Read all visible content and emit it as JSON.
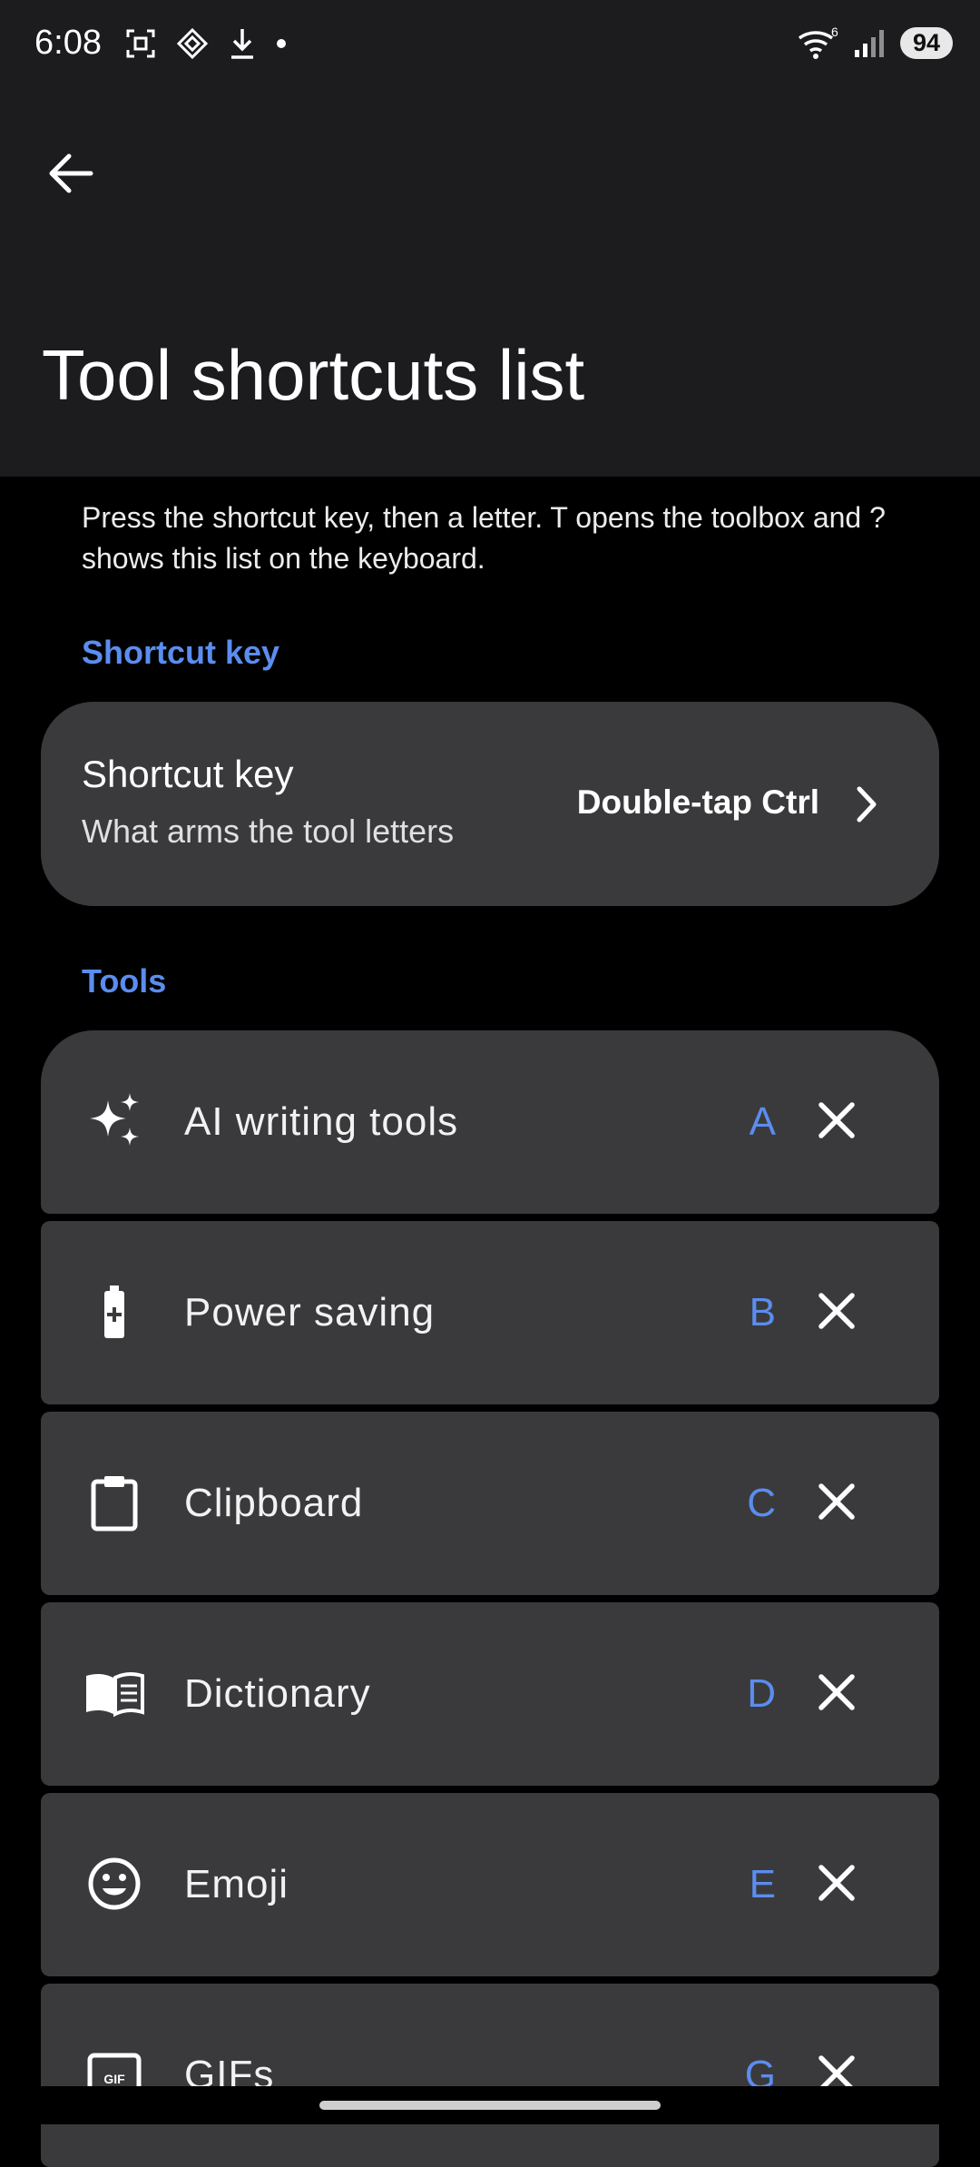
{
  "status": {
    "time": "6:08",
    "battery": "94",
    "icons_left": [
      "screenshot-icon",
      "app-icon",
      "download-icon",
      "dot-icon"
    ],
    "icons_right": [
      "wifi-icon",
      "signal-icon"
    ]
  },
  "header": {
    "title": "Tool shortcuts list",
    "back_icon": "arrow-left-icon"
  },
  "description": "Press the shortcut key, then a letter. T opens the toolbox and ? shows this list on the keyboard.",
  "sections": {
    "shortcut": "Shortcut key",
    "tools": "Tools"
  },
  "shortcut_card": {
    "title": "Shortcut key",
    "subtitle": "What arms the tool letters",
    "value": "Double-tap Ctrl"
  },
  "tools": [
    {
      "label": "AI writing tools",
      "letter": "A",
      "icon": "sparkle-icon"
    },
    {
      "label": "Power saving",
      "letter": "B",
      "icon": "battery-saver-icon"
    },
    {
      "label": "Clipboard",
      "letter": "C",
      "icon": "clipboard-icon"
    },
    {
      "label": "Dictionary",
      "letter": "D",
      "icon": "book-icon"
    },
    {
      "label": "Emoji",
      "letter": "E",
      "icon": "emoji-icon"
    },
    {
      "label": "GIFs",
      "letter": "G",
      "icon": "gif-icon"
    }
  ],
  "colors": {
    "accent": "#5b8def",
    "card": "#3a3a3c",
    "header": "#1c1c1e",
    "background": "#000000"
  }
}
